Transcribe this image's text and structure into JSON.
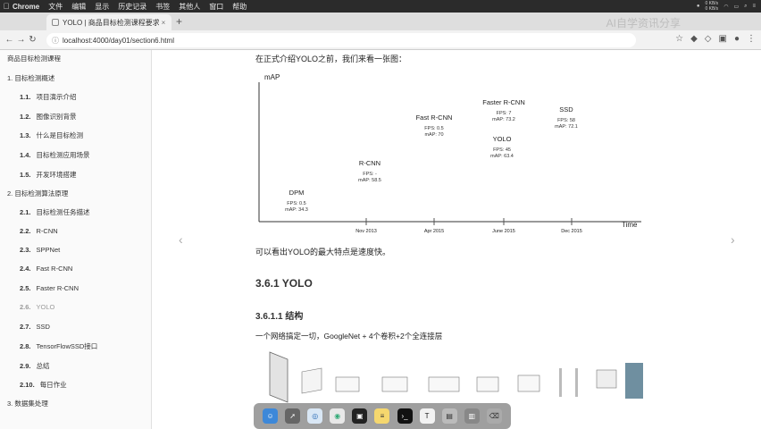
{
  "menubar": {
    "apple_icon": "apple-icon",
    "app_name": "Chrome",
    "menus": [
      "文件",
      "编辑",
      "显示",
      "历史记录",
      "书签",
      "其他人",
      "窗口",
      "帮助"
    ],
    "net_up": "0 KB/s",
    "net_down": "0 KB/s"
  },
  "tab": {
    "title": "YOLO | 商品目标检测课程要求",
    "close": "×"
  },
  "new_tab": "+",
  "watermark": "AI自学资讯分享",
  "address": {
    "url": "localhost:4000/day01/section6.html"
  },
  "sidebar": {
    "book_title": "商品目标检测课程",
    "chapter1": "1. 目标检测概述",
    "ch1_sections": [
      {
        "num": "1.1.",
        "label": "项目演示介绍"
      },
      {
        "num": "1.2.",
        "label": "图像识别背景"
      },
      {
        "num": "1.3.",
        "label": "什么是目标检测"
      },
      {
        "num": "1.4.",
        "label": "目标检测应用场景"
      },
      {
        "num": "1.5.",
        "label": "开发环境搭建"
      }
    ],
    "chapter2": "2. 目标检测算法原理",
    "ch2_sections": [
      {
        "num": "2.1.",
        "label": "目标检测任务描述"
      },
      {
        "num": "2.2.",
        "label": "R-CNN"
      },
      {
        "num": "2.3.",
        "label": "SPPNet"
      },
      {
        "num": "2.4.",
        "label": "Fast R-CNN"
      },
      {
        "num": "2.5.",
        "label": "Faster R-CNN"
      },
      {
        "num": "2.6.",
        "label": "YOLO"
      },
      {
        "num": "2.7.",
        "label": "SSD"
      },
      {
        "num": "2.8.",
        "label": "TensorFlowSSD接口"
      },
      {
        "num": "2.9.",
        "label": "总结"
      },
      {
        "num": "2.10.",
        "label": "每日作业"
      }
    ],
    "chapter3": "3. 数据集处理"
  },
  "content": {
    "intro": "在正式介绍YOLO之前，我们来看一张图：",
    "conclusion": "可以看出YOLO的最大特点是速度快。",
    "h3": "3.6.1 YOLO",
    "h4": "3.6.1.1 结构",
    "desc": "一个网络搞定一切，GoogleNet + 4个卷积+2个全连接层",
    "prev": "‹",
    "next": "›"
  },
  "chart_data": {
    "type": "scatter",
    "ylabel": "mAP",
    "xlabel": "Time",
    "x_ticks": [
      "Nov 2013",
      "Apr 2015",
      "June 2015",
      "Dec 2015"
    ],
    "points": [
      {
        "name": "DPM",
        "fps": "FPS: 0.5",
        "map": "mAP: 34.3"
      },
      {
        "name": "R-CNN",
        "fps": "FPS: -",
        "map": "mAP: 58.5"
      },
      {
        "name": "Fast R-CNN",
        "fps": "FPS: 0.5",
        "map": "mAP: 70"
      },
      {
        "name": "Faster R-CNN",
        "fps": "FPS: 7",
        "map": "mAP: 73.2"
      },
      {
        "name": "YOLO",
        "fps": "FPS: 45",
        "map": "mAP: 63.4"
      },
      {
        "name": "SSD",
        "fps": "FPS: 58",
        "map": "mAP: 72.1"
      }
    ]
  },
  "dock": {
    "icons": [
      "finder-icon",
      "rocket-icon",
      "safari-icon",
      "chrome-icon",
      "pycharm-icon",
      "notes-icon",
      "terminal-icon",
      "typora-icon",
      "preview-icon",
      "stack-icon",
      "trash-icon"
    ]
  }
}
